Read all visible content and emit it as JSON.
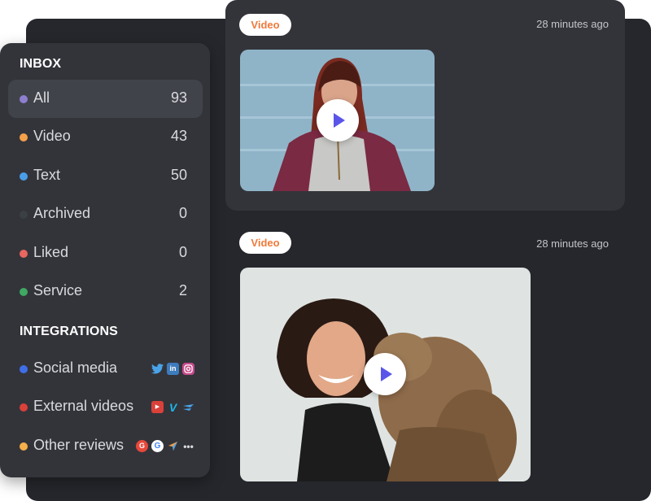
{
  "sidebar": {
    "inbox_title": "INBOX",
    "inbox_items": [
      {
        "label": "All",
        "count": "93",
        "dot": "#8f7fd0"
      },
      {
        "label": "Video",
        "count": "43",
        "dot": "#f5a04a"
      },
      {
        "label": "Text",
        "count": "50",
        "dot": "#4a9ee8"
      },
      {
        "label": "Archived",
        "count": "0",
        "dot": "#3a4044"
      },
      {
        "label": "Liked",
        "count": "0",
        "dot": "#e8675e"
      },
      {
        "label": "Service",
        "count": "2",
        "dot": "#3fa862"
      }
    ],
    "integrations_title": "INTEGRATIONS",
    "integration_items": [
      {
        "label": "Social media",
        "dot": "#3f6ee8",
        "icons": [
          "twitter-icon",
          "linkedin-icon",
          "instagram-icon"
        ]
      },
      {
        "label": "External videos",
        "dot": "#d9413a",
        "icons": [
          "youtube-icon",
          "vimeo-icon",
          "wistia-icon"
        ]
      },
      {
        "label": "Other reviews",
        "dot": "#f5b04a",
        "icons": [
          "g2-icon",
          "google-icon",
          "capterra-icon",
          "more-icon"
        ]
      }
    ]
  },
  "feed": [
    {
      "badge": "Video",
      "time": "28 minutes ago"
    },
    {
      "badge": "Video",
      "time": "28 minutes ago"
    }
  ],
  "colors": {
    "background": "#26272c",
    "panel": "#33343a",
    "badge_text": "#f07a3c",
    "play_icon": "#5a55e8"
  }
}
